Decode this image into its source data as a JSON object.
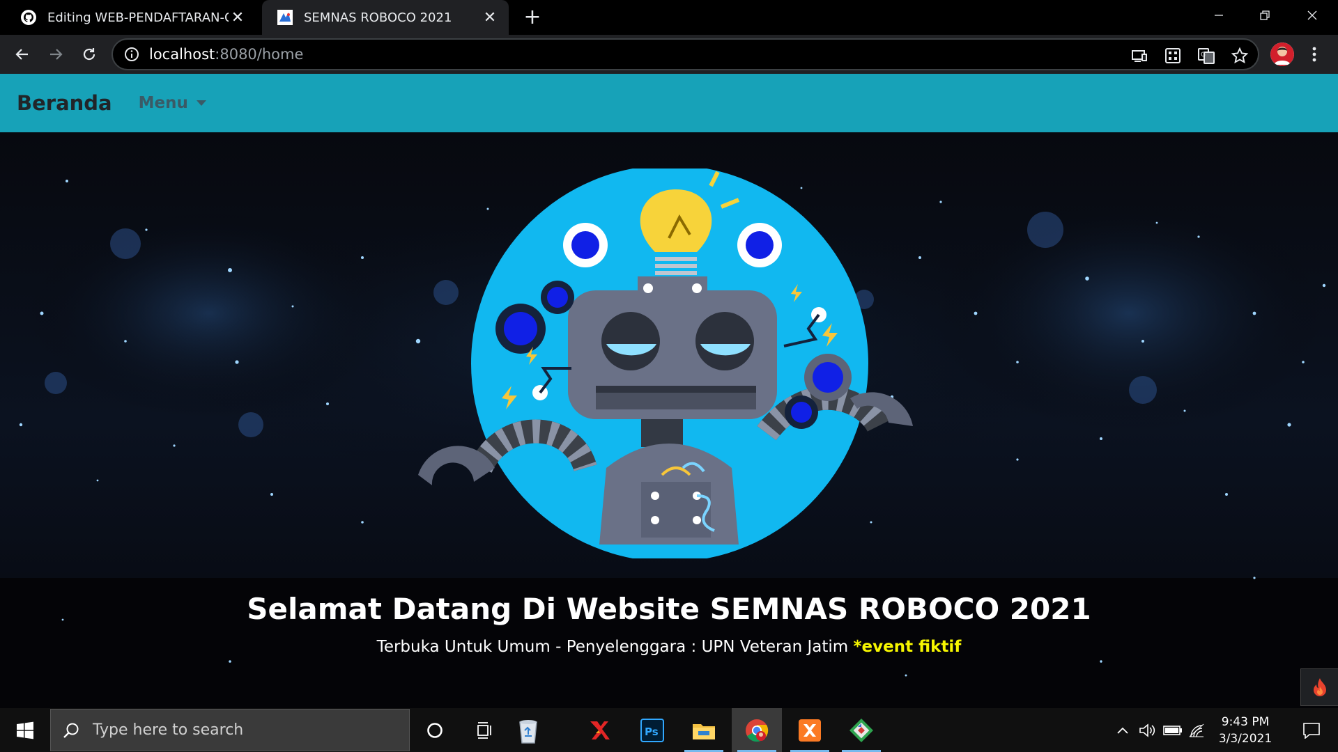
{
  "browser": {
    "tabs": [
      {
        "title": "Editing WEB-PENDAFTARAN-CO",
        "favicon": "github-icon",
        "active": false
      },
      {
        "title": "SEMNAS ROBOCO 2021",
        "favicon": "site-logo-icon",
        "active": true
      }
    ],
    "url_host": "localhost",
    "url_rest": ":8080/home"
  },
  "site": {
    "brand": "Beranda",
    "menu_label": "Menu",
    "navbar_color": "#17a2b8"
  },
  "hero": {
    "headline": "Selamat Datang Di Website SEMNAS ROBOCO 2021",
    "subline": "Terbuka Untuk Umum - Penyelenggara : UPN Veteran Jatim",
    "note": "*event fiktif",
    "note_color": "#f7f700",
    "illustration": "robot-illustration"
  },
  "taskbar": {
    "search_placeholder": "Type here to search",
    "apps": [
      "cortana-icon",
      "task-view-icon",
      "recycle-bin-icon",
      "xampp-x-icon",
      "photoshop-icon",
      "file-explorer-icon",
      "chrome-icon",
      "xampp-control-icon",
      "git-icon"
    ],
    "time": "9:43 PM",
    "date": "3/3/2021"
  }
}
